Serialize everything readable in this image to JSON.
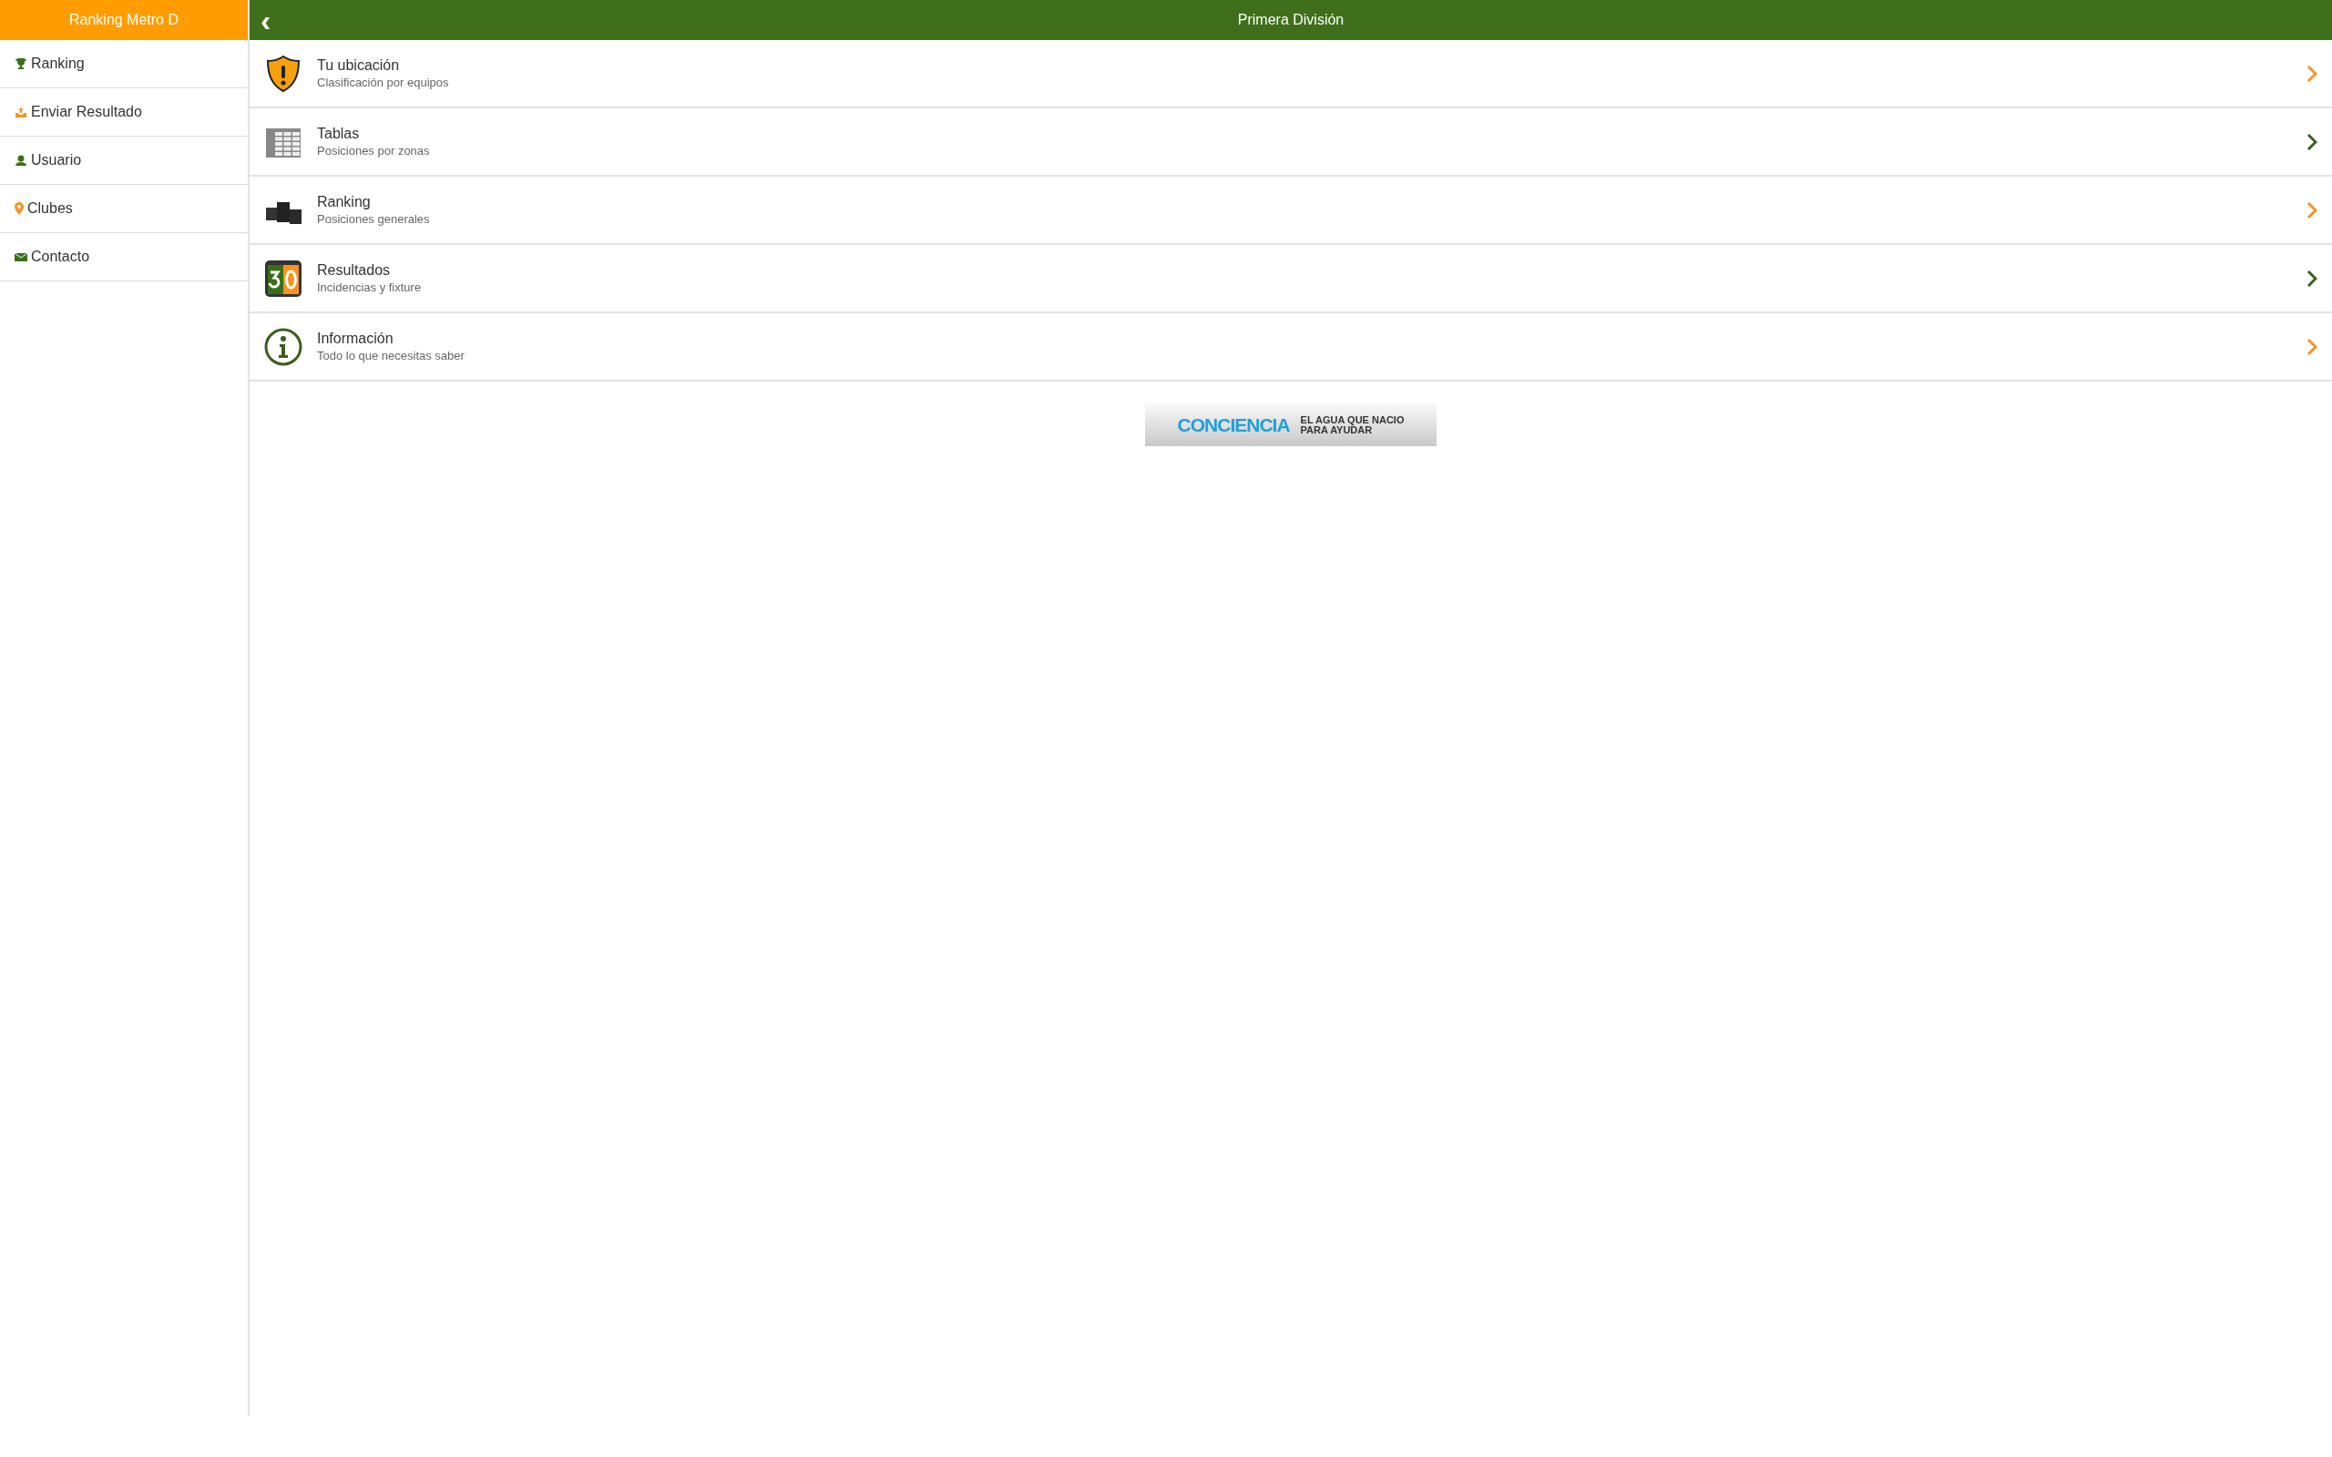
{
  "sidebar": {
    "title": "Ranking Metro D",
    "items": [
      {
        "label": "Ranking",
        "kind": "trophy"
      },
      {
        "label": "Enviar Resultado",
        "kind": "upload"
      },
      {
        "label": "Usuario",
        "kind": "user"
      },
      {
        "label": "Clubes",
        "kind": "pin"
      },
      {
        "label": "Contacto",
        "kind": "mail"
      }
    ]
  },
  "header": {
    "title": "Primera División",
    "back": "‹"
  },
  "menu": [
    {
      "title": "Tu ubicación",
      "subtitle": "Clasificación por equipos",
      "kind": "shield",
      "color": "#f7931e"
    },
    {
      "title": "Tablas",
      "subtitle": "Posiciones por zonas",
      "kind": "table",
      "color": "#3b5e1a"
    },
    {
      "title": "Ranking",
      "subtitle": "Posiciones generales",
      "kind": "podium",
      "color": "#f7931e"
    },
    {
      "title": "Resultados",
      "subtitle": "Incidencias y fixture",
      "kind": "score",
      "color": "#3b5e1a"
    },
    {
      "title": "Información",
      "subtitle": "Todo lo que necesitas saber",
      "kind": "info",
      "color": "#f7931e"
    }
  ],
  "banner": {
    "brand": "CONCIENCIA",
    "tagline_1": "EL AGUA QUE NACIO",
    "tagline_2": "PARA AYUDAR"
  }
}
